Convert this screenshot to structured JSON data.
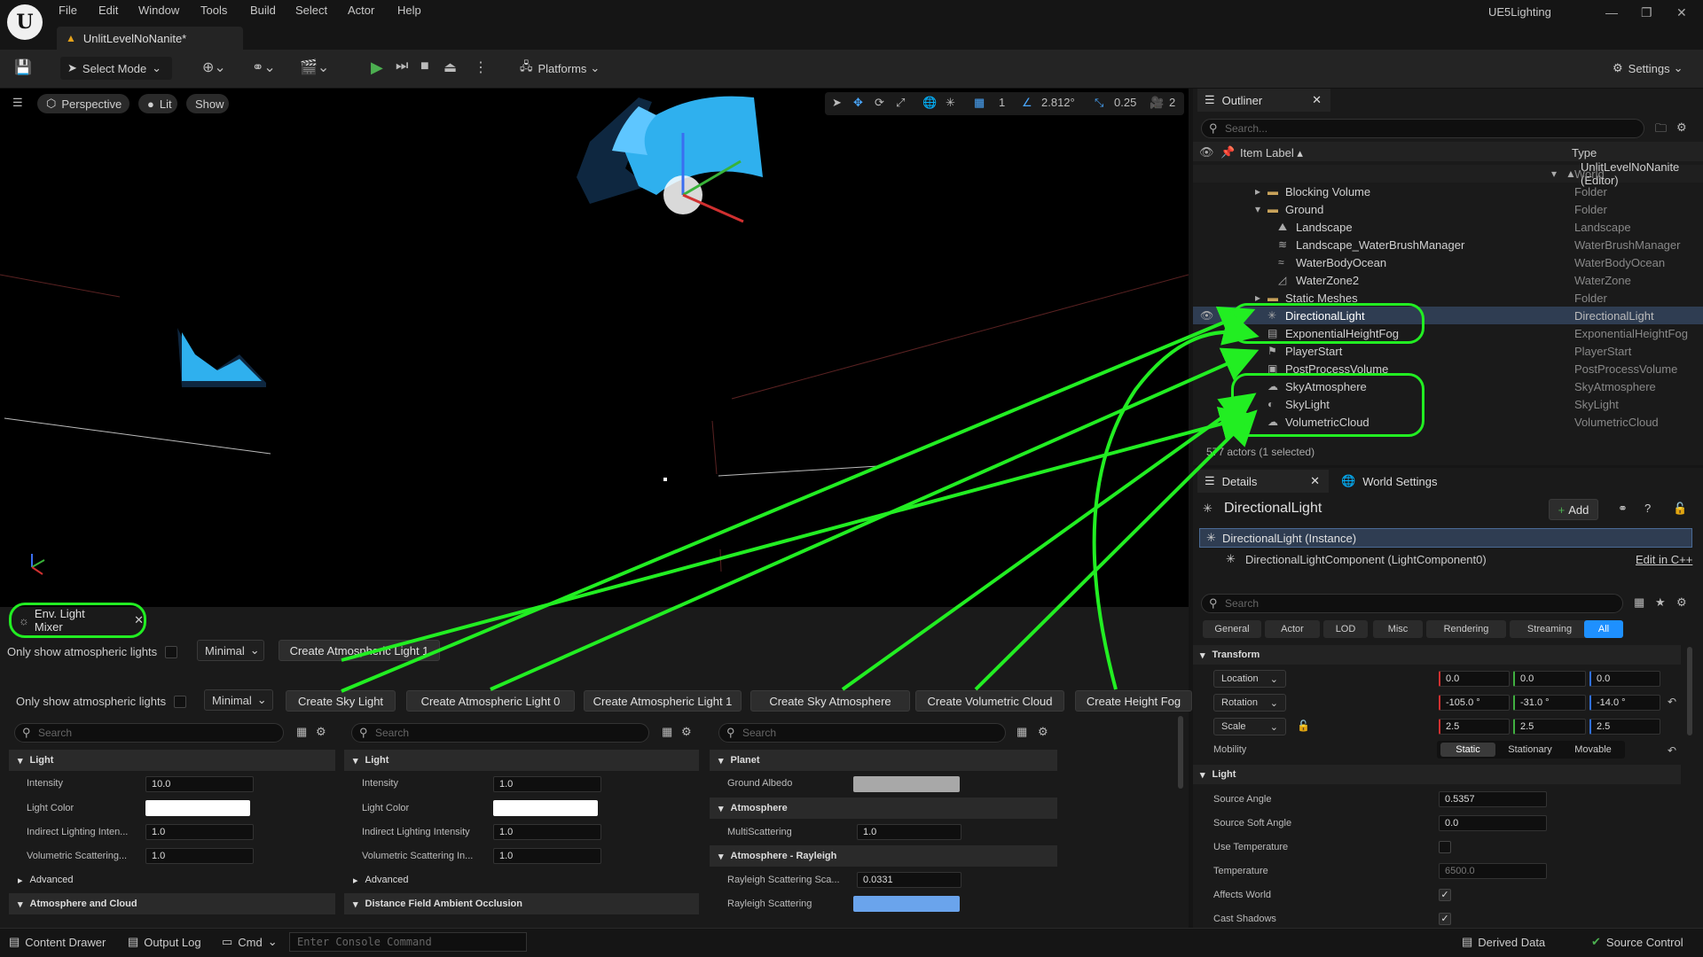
{
  "menu": [
    "File",
    "Edit",
    "Window",
    "Tools",
    "Build",
    "Select",
    "Actor",
    "Help"
  ],
  "project_name": "UE5Lighting",
  "document_tab": "UnlitLevelNoNanite*",
  "toolbar": {
    "select_mode": "Select Mode",
    "platforms": "Platforms",
    "settings": "Settings"
  },
  "viewport": {
    "perspective": "Perspective",
    "lit": "Lit",
    "show": "Show",
    "angle_snap": "2.812°",
    "scale_snap": "0.25",
    "grid_snap": "1",
    "camera_speed": "2"
  },
  "mixer": {
    "tab_label": "Env. Light Mixer",
    "only_show_label": "Only show atmospheric lights",
    "minimal": "Minimal",
    "top_button": "Create Atmospheric Light 1",
    "buttons": [
      "Create Sky Light",
      "Create Atmospheric Light 0",
      "Create Atmospheric Light 1",
      "Create Sky Atmosphere",
      "Create Volumetric Cloud",
      "Create Height Fog"
    ],
    "search_placeholder": "Search",
    "col1": {
      "section": "Light",
      "intensity_label": "Intensity",
      "intensity": "10.0",
      "color_label": "Light Color",
      "indirect_label": "Indirect Lighting Inten...",
      "indirect": "1.0",
      "vol_label": "Volumetric Scattering...",
      "vol": "1.0",
      "advanced": "Advanced",
      "section2": "Atmosphere and Cloud"
    },
    "col2": {
      "section": "Light",
      "intensity_label": "Intensity",
      "intensity": "1.0",
      "color_label": "Light Color",
      "indirect_label": "Indirect Lighting Intensity",
      "indirect": "1.0",
      "vol_label": "Volumetric Scattering In...",
      "vol": "1.0",
      "advanced": "Advanced",
      "section2": "Distance Field Ambient Occlusion"
    },
    "col3": {
      "section": "Planet",
      "albedo_label": "Ground Albedo",
      "section2": "Atmosphere",
      "multi_label": "MultiScattering",
      "multi": "1.0",
      "section3": "Atmosphere - Rayleigh",
      "ray_scale_label": "Rayleigh Scattering Sca...",
      "ray_scale": "0.0331",
      "ray_label": "Rayleigh Scattering"
    }
  },
  "outliner": {
    "title": "Outliner",
    "search_placeholder": "Search...",
    "col_label": "Item Label",
    "col_type": "Type",
    "rows": [
      {
        "label": "UnlitLevelNoNanite (Editor)",
        "type": "World"
      },
      {
        "label": "Blocking Volume",
        "type": "Folder"
      },
      {
        "label": "Ground",
        "type": "Folder"
      },
      {
        "label": "Landscape",
        "type": "Landscape"
      },
      {
        "label": "Landscape_WaterBrushManager",
        "type": "WaterBrushManager"
      },
      {
        "label": "WaterBodyOcean",
        "type": "WaterBodyOcean"
      },
      {
        "label": "WaterZone2",
        "type": "WaterZone"
      },
      {
        "label": "Static Meshes",
        "type": "Folder"
      },
      {
        "label": "DirectionalLight",
        "type": "DirectionalLight"
      },
      {
        "label": "ExponentialHeightFog",
        "type": "ExponentialHeightFog"
      },
      {
        "label": "PlayerStart",
        "type": "PlayerStart"
      },
      {
        "label": "PostProcessVolume",
        "type": "PostProcessVolume"
      },
      {
        "label": "SkyAtmosphere",
        "type": "SkyAtmosphere"
      },
      {
        "label": "SkyLight",
        "type": "SkyLight"
      },
      {
        "label": "VolumetricCloud",
        "type": "VolumetricCloud"
      }
    ],
    "footer": "577 actors (1 selected)"
  },
  "details": {
    "tab": "Details",
    "world_settings": "World Settings",
    "actor_name": "DirectionalLight",
    "add": "Add",
    "instance": "DirectionalLight (Instance)",
    "component": "DirectionalLightComponent (LightComponent0)",
    "edit_cpp": "Edit in C++",
    "search_placeholder": "Search",
    "tabs": [
      "General",
      "Actor",
      "LOD",
      "Misc",
      "Rendering",
      "Streaming",
      "All"
    ],
    "transform": "Transform",
    "location_label": "Location",
    "location": [
      "0.0",
      "0.0",
      "0.0"
    ],
    "rotation_label": "Rotation",
    "rotation": [
      "-105.0 °",
      "-31.0 °",
      "-14.0 °"
    ],
    "scale_label": "Scale",
    "scale": [
      "2.5",
      "2.5",
      "2.5"
    ],
    "mobility_label": "Mobility",
    "mobility": [
      "Static",
      "Stationary",
      "Movable"
    ],
    "light": "Light",
    "source_angle_label": "Source Angle",
    "source_angle": "0.5357",
    "soft_angle_label": "Source Soft Angle",
    "soft_angle": "0.0",
    "use_temp_label": "Use Temperature",
    "temp_label": "Temperature",
    "temp": "6500.0",
    "affects_label": "Affects World",
    "shadows_label": "Cast Shadows"
  },
  "status": {
    "content_drawer": "Content Drawer",
    "output_log": "Output Log",
    "cmd": "Cmd",
    "console_placeholder": "Enter Console Command",
    "derived": "Derived Data",
    "source": "Source Control"
  },
  "colors": {
    "highlight": "#22ee22",
    "accent": "#1e90ff",
    "selected_row": "#2f3d52"
  }
}
